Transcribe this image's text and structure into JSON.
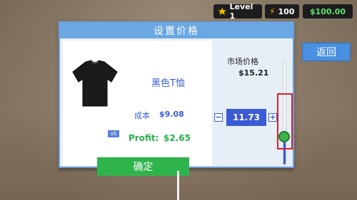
{
  "hud": {
    "level_label": "Level 1",
    "energy": "100",
    "money": "$100.00"
  },
  "back_button": "返回",
  "dialog": {
    "title": "设置价格",
    "product_name": "黑色T恤",
    "cost_label": "成本",
    "cost_value": "$9.08",
    "qty_badge": "x5",
    "profit_label": "Profit:",
    "profit_value": "$2.65",
    "confirm_label": "确定",
    "market_label": "市场价格",
    "market_value": "$15.21",
    "minus_label": "−",
    "price_value": "11.73",
    "plus_label": "+"
  },
  "slider": {
    "level": 0.27
  },
  "colors": {
    "accent": "#3b5bd3",
    "profit": "#27b24a",
    "header": "#6aa7e3",
    "confirm": "#2fb44b",
    "highlight": "#e0202a"
  },
  "icons": {
    "level": "star-icon",
    "energy": "bolt-icon",
    "product": "tshirt-icon"
  }
}
